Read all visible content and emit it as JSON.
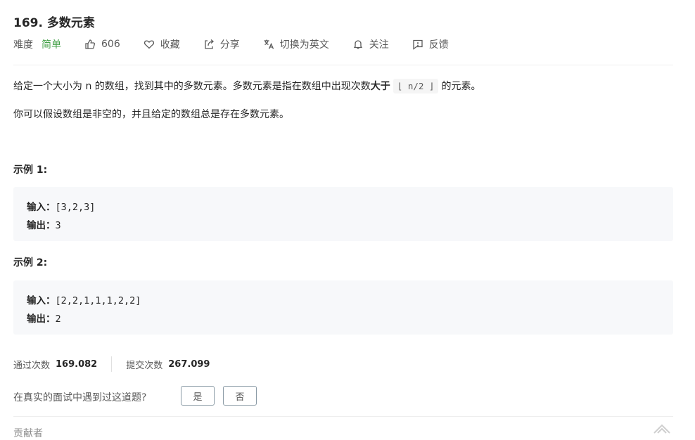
{
  "problem": {
    "title": "169. 多数元素",
    "difficulty_label": "难度",
    "difficulty": "简单",
    "likes": "606",
    "favorite_label": "收藏",
    "share_label": "分享",
    "switch_lang_label": "切换为英文",
    "follow_label": "关注",
    "feedback_label": "反馈",
    "colors": {
      "easy": "#43a047",
      "text": "#262626",
      "muted": "#595959"
    }
  },
  "description": {
    "p1_before": "给定一个大小为 n 的数组，找到其中的多数元素。多数元素是指在数组中出现次数",
    "p1_bold": "大于",
    "p1_code": "⌊ n/2 ⌋",
    "p1_after": "的元素。",
    "p2": "你可以假设数组是非空的，并且给定的数组总是存在多数元素。"
  },
  "examples": [
    {
      "title": "示例 1:",
      "input_label": "输入：",
      "input": "[3,2,3]",
      "output_label": "输出：",
      "output": "3"
    },
    {
      "title": "示例 2:",
      "input_label": "输入：",
      "input": "[2,2,1,1,1,2,2]",
      "output_label": "输出：",
      "output": "2"
    }
  ],
  "stats": {
    "accepted_label": "通过次数",
    "accepted": "169.082",
    "submissions_label": "提交次数",
    "submissions": "267.099"
  },
  "interview": {
    "question": "在真实的面试中遇到过这道题?",
    "yes": "是",
    "no": "否"
  },
  "contributors_label": "贡献者",
  "icons": [
    "thumbs-up-icon",
    "heart-icon",
    "share-icon",
    "translate-icon",
    "bell-icon",
    "feedback-icon",
    "corner-icon"
  ]
}
